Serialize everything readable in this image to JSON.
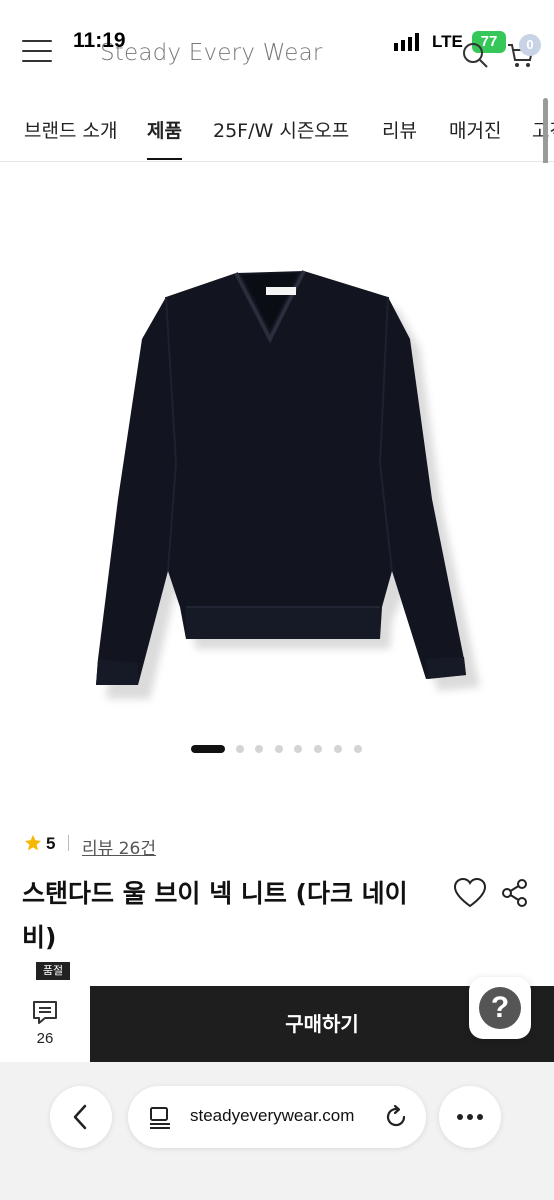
{
  "status_bar": {
    "time": "11:19",
    "network": "LTE",
    "battery": "77"
  },
  "header": {
    "brand": "Steady Every Wear",
    "cart_count": "0"
  },
  "nav": {
    "tabs": [
      {
        "label": "브랜드 소개",
        "active": false
      },
      {
        "label": "제품",
        "active": true
      },
      {
        "label": "25F/W 시즌오프",
        "active": false
      },
      {
        "label": "리뷰",
        "active": false
      },
      {
        "label": "매거진",
        "active": false
      },
      {
        "label": "고객",
        "active": false
      }
    ]
  },
  "gallery": {
    "image_count": 8,
    "active_index": 0
  },
  "product": {
    "rating": "5",
    "review_link": "리뷰 26건",
    "title": "스탠다드 울 브이 넥 니트 (다크 네이비)",
    "badge": "품절"
  },
  "action_bar": {
    "review_count": "26",
    "buy_label": "구매하기",
    "help_label": "?"
  },
  "browser": {
    "url": "steadyeverywear.com"
  },
  "colors": {
    "primary": "#1e1e1e",
    "star": "#f5b800",
    "battery": "#35c759",
    "product": "#12151f"
  }
}
